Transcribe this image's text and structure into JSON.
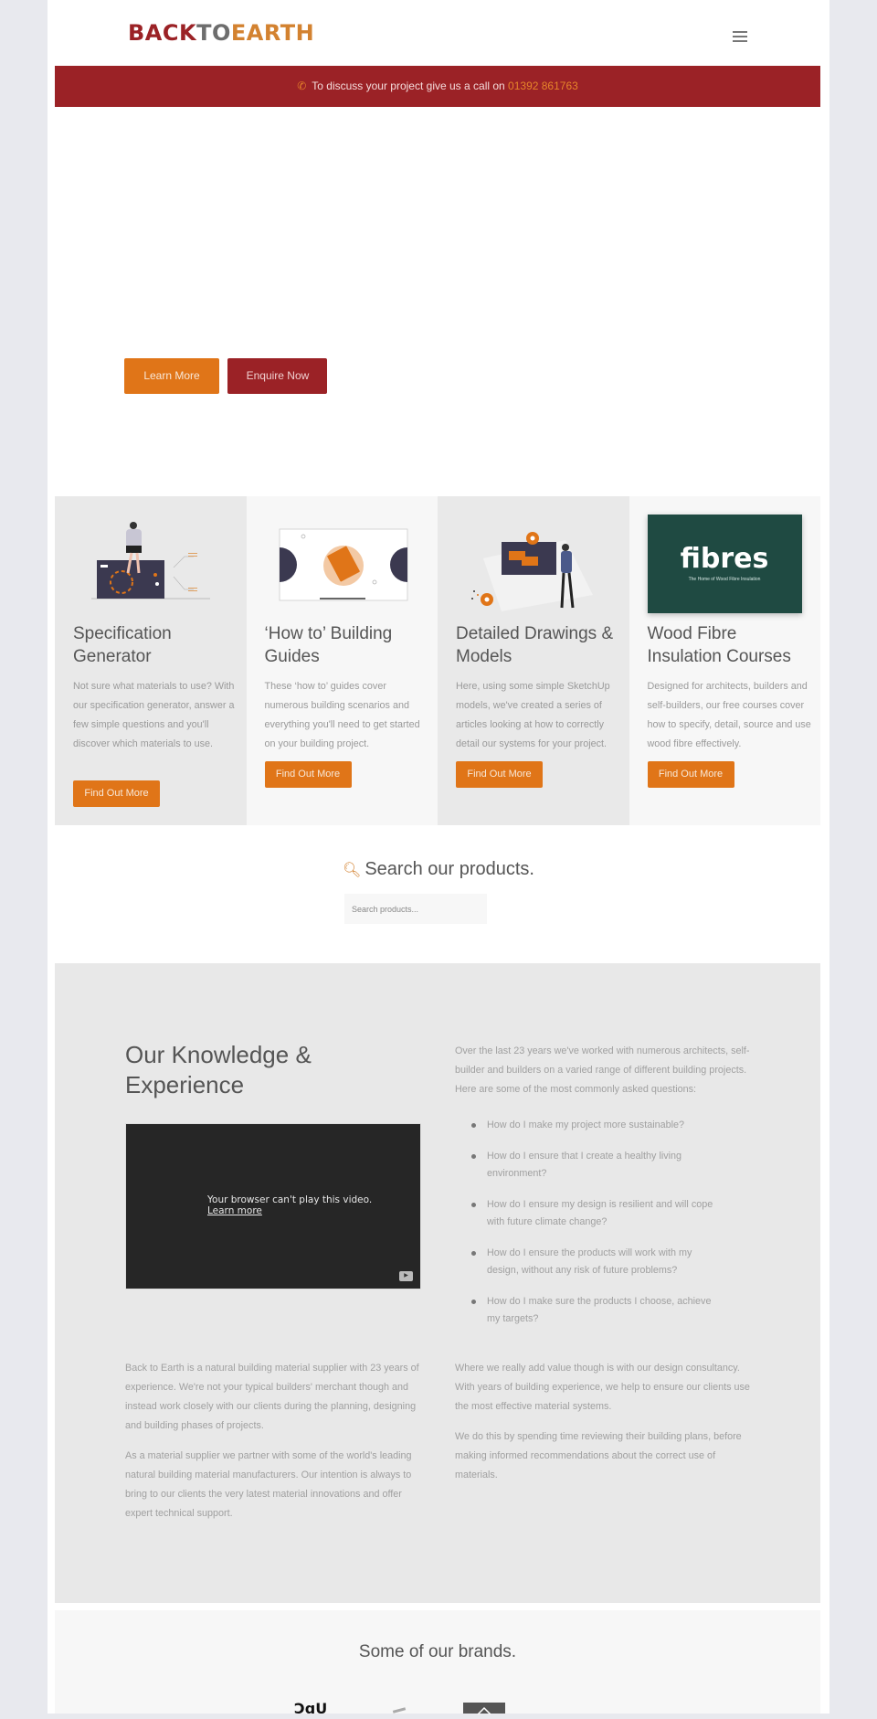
{
  "header": {
    "logo": {
      "part1": "BACK",
      "part2": "TO",
      "part3": "EARTH"
    },
    "menu_icon": "hamburger-icon"
  },
  "callbar": {
    "icon": "phone-icon",
    "text": "To discuss your project give us a call on",
    "phone": "01392 861763"
  },
  "hero": {
    "buttons": [
      {
        "label": "Learn More"
      },
      {
        "label": "Enquire Now"
      }
    ]
  },
  "cards": [
    {
      "title": "Specification Generator",
      "text": "Not sure what materials to use? With our specification generator, answer a few simple questions and you'll discover which materials to use.",
      "button": "Find Out More",
      "image": "specification-illustration"
    },
    {
      "title": "‘How to’ Building Guides",
      "text": "These ‘how to’ guides cover numerous building scenarios and everything you'll need to get started on your building project.",
      "button": "Find Out More",
      "image": "guides-book-illustration"
    },
    {
      "title": "Detailed Drawings & Models",
      "text": "Here, using some simple SketchUp models, we've created a series of articles looking at how to correctly detail our systems for your project.",
      "button": "Find Out More",
      "image": "drawings-presentation-illustration"
    },
    {
      "title": "Wood Fibre Insulation Courses",
      "text": "Designed for architects, builders and self-builders, our free courses cover how to specify, detail, source and use wood fibre effectively.",
      "button": "Find Out More",
      "image": "fibres-logo",
      "fibres_logo": {
        "name": "fibres",
        "tagline": "The Home of Wood Fibre Insulation",
        "bg": "#1f4a42"
      }
    }
  ],
  "search": {
    "title": "Search our products.",
    "icon": "magnifier-icon",
    "placeholder": "Search products..."
  },
  "knowledge": {
    "title": "Our Knowledge & Experience",
    "video": {
      "message": "Your browser can't play this video.",
      "link": "Learn more"
    },
    "intro": "Over the last 23 years we've worked with numerous architects, self-builder and builders on a varied range of different building projects. Here are some of the most commonly asked questions:",
    "questions": [
      "How do I make my project more sustainable?",
      "How do I ensure that I create a healthy living environment?",
      "How do I ensure my design is resilient and will cope with future climate change?",
      "How do I ensure the products will work with my design, without any risk of future problems?",
      "How do I make sure the products I choose, achieve my targets?"
    ],
    "left_paragraphs": [
      "Back to Earth is a natural building material supplier with 23 years of experience. We're not your typical builders' merchant though and instead work closely with our clients during the planning, designing and building phases of projects.",
      "As a material supplier we partner with some of the world's leading natural building material manufacturers. Our intention is always to bring to our clients the very latest material innovations and offer expert technical support."
    ],
    "right_paragraphs": [
      "Where we really add value though is with our design consultancy. With years of building experience, we help to ensure our clients use the most effective material systems.",
      "We do this by spending time reviewing their building plans, before making informed recommendations about the correct use of materials."
    ]
  },
  "brands": {
    "title": "Some of our brands.",
    "logos": [
      "brand-logo-1",
      "brand-logo-2",
      "brand-logo-3"
    ]
  },
  "colors": {
    "brand_red": "#9b2226",
    "brand_orange": "#e07518",
    "logo_grey": "#6d6d6d",
    "fibres_green": "#1f4a42"
  }
}
